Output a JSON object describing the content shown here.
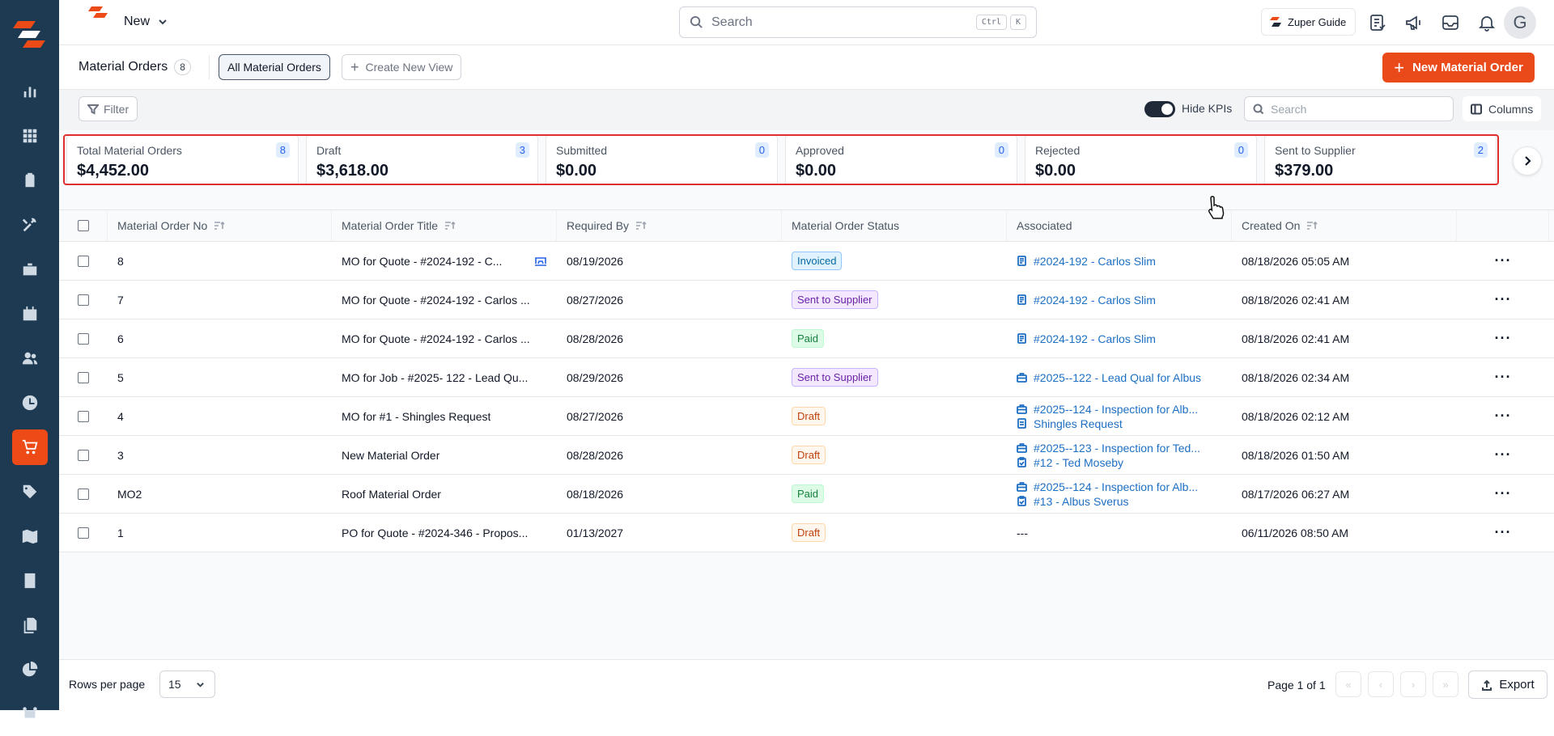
{
  "header": {
    "new_label": "New",
    "search_placeholder": "Search",
    "search_shortcut": [
      "Ctrl",
      "K"
    ],
    "guide_label": "Zuper Guide",
    "avatar_initial": "G",
    "icons": [
      "checklist-icon",
      "megaphone-icon",
      "inbox-icon",
      "bell-icon"
    ]
  },
  "sidebar": {
    "items": [
      {
        "icon": "chart-icon"
      },
      {
        "icon": "grid-icon"
      },
      {
        "icon": "clipboard-icon"
      },
      {
        "icon": "tools-icon"
      },
      {
        "icon": "briefcase-icon"
      },
      {
        "icon": "calendar-icon"
      },
      {
        "icon": "users-icon"
      },
      {
        "icon": "clock-icon"
      },
      {
        "icon": "cart-icon",
        "active": true
      },
      {
        "icon": "tag-icon"
      },
      {
        "icon": "map-icon"
      },
      {
        "icon": "calculator-icon"
      },
      {
        "icon": "documents-icon"
      },
      {
        "icon": "pie-icon"
      },
      {
        "icon": "workflow-icon"
      }
    ]
  },
  "viewbar": {
    "title": "Material Orders",
    "count": "8",
    "active_view": "All Material Orders",
    "create_view": "Create New View",
    "new_button": "New Material Order"
  },
  "toolbar": {
    "filter_label": "Filter",
    "hide_kpis_label": "Hide KPIs",
    "hide_kpis_on": true,
    "search_placeholder": "Search",
    "columns_label": "Columns"
  },
  "kpis": [
    {
      "label": "Total Material Orders",
      "count": "8",
      "value": "$4,452.00"
    },
    {
      "label": "Draft",
      "count": "3",
      "value": "$3,618.00"
    },
    {
      "label": "Submitted",
      "count": "0",
      "value": "$0.00"
    },
    {
      "label": "Approved",
      "count": "0",
      "value": "$0.00"
    },
    {
      "label": "Rejected",
      "count": "0",
      "value": "$0.00"
    },
    {
      "label": "Sent to Supplier",
      "count": "2",
      "value": "$379.00"
    }
  ],
  "table": {
    "columns": [
      "Material Order No",
      "Material Order Title",
      "Required By",
      "Material Order Status",
      "Associated",
      "Created On"
    ],
    "rows": [
      {
        "no": "8",
        "title": "MO for Quote - #2024-192 - C...",
        "required": "08/19/2026",
        "status": "Invoiced",
        "status_kind": "invoiced",
        "assoc": [
          {
            "icon": "quote-icon",
            "text": "#2024-192 - Carlos Slim"
          }
        ],
        "created": "08/18/2026 05:05 AM",
        "title_icon": true
      },
      {
        "no": "7",
        "title": "MO for Quote - #2024-192 - Carlos ...",
        "required": "08/27/2026",
        "status": "Sent to Supplier",
        "status_kind": "sent",
        "assoc": [
          {
            "icon": "quote-icon",
            "text": "#2024-192 - Carlos Slim"
          }
        ],
        "created": "08/18/2026 02:41 AM"
      },
      {
        "no": "6",
        "title": "MO for Quote - #2024-192 - Carlos ...",
        "required": "08/28/2026",
        "status": "Paid",
        "status_kind": "paid",
        "assoc": [
          {
            "icon": "quote-icon",
            "text": "#2024-192 - Carlos Slim"
          }
        ],
        "created": "08/18/2026 02:41 AM"
      },
      {
        "no": "5",
        "title": "MO for Job - #2025- 122 - Lead Qu...",
        "required": "08/29/2026",
        "status": "Sent to Supplier",
        "status_kind": "sent",
        "assoc": [
          {
            "icon": "briefcase-icon",
            "text": "#2025--122 - Lead Qual for Albus"
          }
        ],
        "created": "08/18/2026 02:34 AM"
      },
      {
        "no": "4",
        "title": "MO for #1 - Shingles Request",
        "required": "08/27/2026",
        "status": "Draft",
        "status_kind": "draft",
        "assoc": [
          {
            "icon": "briefcase-icon",
            "text": "#2025--124 - Inspection for Alb..."
          },
          {
            "icon": "request-icon",
            "text": "Shingles Request"
          }
        ],
        "created": "08/18/2026 02:12 AM"
      },
      {
        "no": "3",
        "title": "New Material Order",
        "required": "08/28/2026",
        "status": "Draft",
        "status_kind": "draft",
        "assoc": [
          {
            "icon": "briefcase-icon",
            "text": "#2025--123 - Inspection for Ted..."
          },
          {
            "icon": "clipboard-check-icon",
            "text": "#12 - Ted Moseby"
          }
        ],
        "created": "08/18/2026 01:50 AM"
      },
      {
        "no": "MO2",
        "title": "Roof Material Order",
        "required": "08/18/2026",
        "status": "Paid",
        "status_kind": "paid",
        "assoc": [
          {
            "icon": "briefcase-icon",
            "text": "#2025--124 - Inspection for Alb..."
          },
          {
            "icon": "clipboard-check-icon",
            "text": "#13 - Albus Sverus"
          }
        ],
        "created": "08/17/2026 06:27 AM"
      },
      {
        "no": "1",
        "title": "PO for Quote - #2024-346 - Propos...",
        "required": "01/13/2027",
        "status": "Draft",
        "status_kind": "draft",
        "assoc_text": "---",
        "created": "06/11/2026 08:50 AM"
      }
    ]
  },
  "footer": {
    "rows_per_page_label": "Rows per page",
    "rows_per_page": "15",
    "page_info": "Page 1 of 1",
    "export_label": "Export"
  },
  "colors": {
    "sidebar_bg": "#1d3a52",
    "accent": "#ea4a19",
    "kpi_highlight": "#e02d2d",
    "link": "#1d6fc4"
  }
}
